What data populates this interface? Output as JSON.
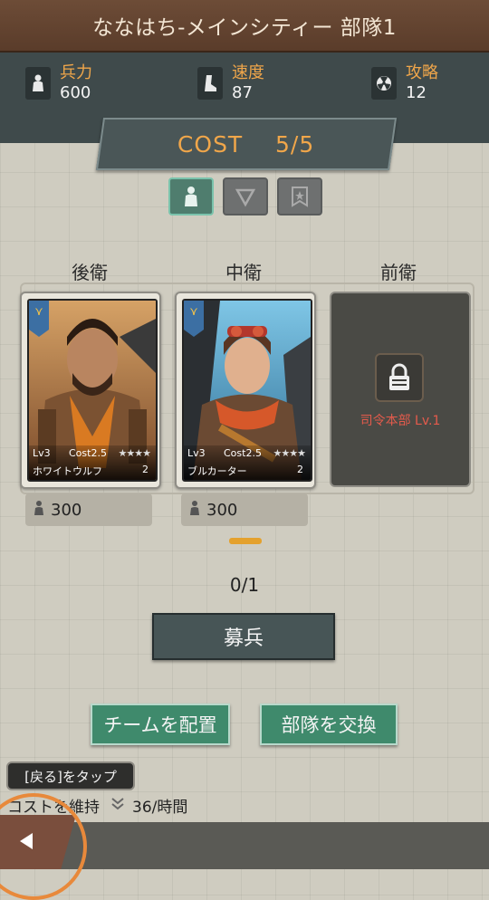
{
  "title": "ななはち-メインシティー 部隊1",
  "stats": [
    {
      "label": "兵力",
      "value": "600",
      "icon": "soldier-icon"
    },
    {
      "label": "速度",
      "value": "87",
      "icon": "boot-icon"
    },
    {
      "label": "攻略",
      "value": "12",
      "icon": "radiation-icon"
    }
  ],
  "cost": "COST    5/5",
  "columns": [
    "後衛",
    "中衛",
    "前衛"
  ],
  "cards": [
    {
      "lv": "Lv3",
      "cost": "Cost2.5",
      "stars": "★★★★",
      "name": "ホワイトウルフ",
      "count": "2",
      "troops": "300"
    },
    {
      "lv": "Lv3",
      "cost": "Cost2.5",
      "stars": "★★★★",
      "name": "ブルカーター",
      "count": "2",
      "troops": "300"
    }
  ],
  "locked_slot": {
    "requirement": "司令本部 Lv.1"
  },
  "recruit_count": "0/1",
  "buttons": {
    "recruit": "募兵",
    "deploy": "チームを配置",
    "swap": "部隊を交換"
  },
  "hint": "[戻る]をタップ",
  "upkeep": {
    "label": "コストを維持",
    "value": "36/時間"
  },
  "colors": {
    "accent_orange": "#f0a64a",
    "green_button": "#3f8a6c",
    "title_brown": "#6d4c37",
    "lock_red": "#e45b4c"
  }
}
